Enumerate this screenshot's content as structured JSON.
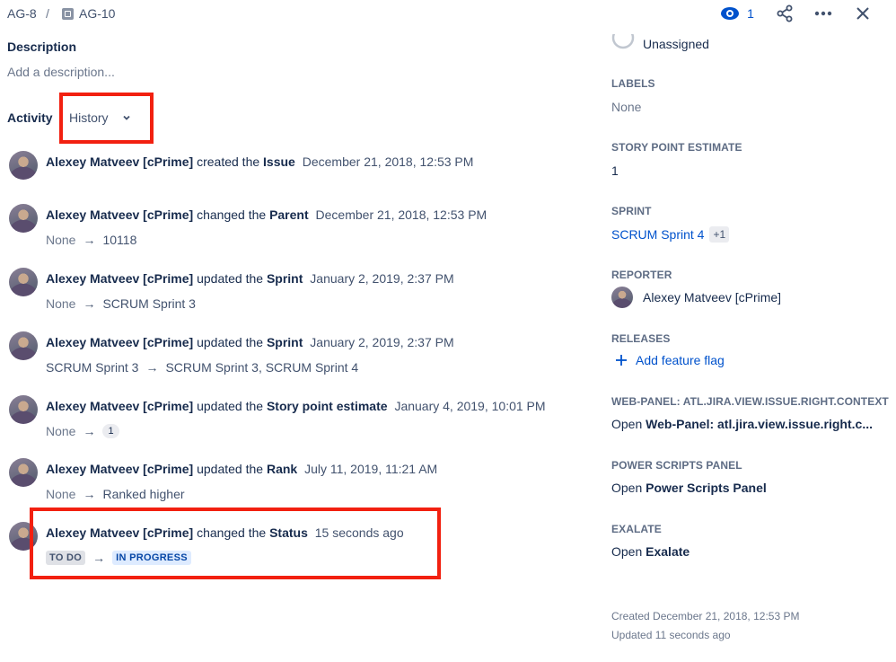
{
  "header": {
    "parent_key": "AG-8",
    "separator": "/",
    "issue_key": "AG-10",
    "watch_count": "1"
  },
  "description": {
    "title": "Description",
    "placeholder": "Add a description..."
  },
  "activity": {
    "title": "Activity",
    "filter_label": "History",
    "items": [
      {
        "user": "Alexey Matveev [cPrime]",
        "verb": "created the",
        "field": "Issue",
        "time": "December 21, 2018, 12:53 PM",
        "from": "",
        "to": ""
      },
      {
        "user": "Alexey Matveev [cPrime]",
        "verb": "changed the",
        "field": "Parent",
        "time": "December 21, 2018, 12:53 PM",
        "from": "None",
        "to": "10118"
      },
      {
        "user": "Alexey Matveev [cPrime]",
        "verb": "updated the",
        "field": "Sprint",
        "time": "January 2, 2019, 2:37 PM",
        "from": "None",
        "to": "SCRUM Sprint 3"
      },
      {
        "user": "Alexey Matveev [cPrime]",
        "verb": "updated the",
        "field": "Sprint",
        "time": "January 2, 2019, 2:37 PM",
        "from": "SCRUM Sprint 3",
        "to": "SCRUM Sprint 3, SCRUM Sprint 4"
      },
      {
        "user": "Alexey Matveev [cPrime]",
        "verb": "updated the",
        "field": "Story point estimate",
        "time": "January 4, 2019, 10:01 PM",
        "from": "None",
        "to": "1"
      },
      {
        "user": "Alexey Matveev [cPrime]",
        "verb": "updated the",
        "field": "Rank",
        "time": "July 11, 2019, 11:21 AM",
        "from": "None",
        "to": "Ranked higher"
      },
      {
        "user": "Alexey Matveev [cPrime]",
        "verb": "changed the",
        "field": "Status",
        "time": "15 seconds ago",
        "from": "TO DO",
        "to": "IN PROGRESS"
      }
    ]
  },
  "sidebar": {
    "assignee": "Unassigned",
    "labels_label": "LABELS",
    "labels_value": "None",
    "story_points_label": "STORY POINT ESTIMATE",
    "story_points_value": "1",
    "sprint_label": "SPRINT",
    "sprint_value": "SCRUM Sprint 4",
    "sprint_more": "+1",
    "reporter_label": "REPORTER",
    "reporter_value": "Alexey Matveev [cPrime]",
    "releases_label": "RELEASES",
    "releases_action": "Add feature flag",
    "webpanel_label": "WEB-PANEL: ATL.JIRA.VIEW.ISSUE.RIGHT.CONTEXT",
    "webpanel_prefix": "Open",
    "webpanel_value": "Web-Panel: atl.jira.view.issue.right.c...",
    "powerscripts_label": "POWER SCRIPTS PANEL",
    "powerscripts_prefix": "Open",
    "powerscripts_value": "Power Scripts Panel",
    "exalate_label": "EXALATE",
    "exalate_prefix": "Open",
    "exalate_value": "Exalate",
    "created": "Created December 21, 2018, 12:53 PM",
    "updated": "Updated 11 seconds ago"
  },
  "colors": {
    "accent": "#0052CC",
    "highlight": "#F22010"
  }
}
